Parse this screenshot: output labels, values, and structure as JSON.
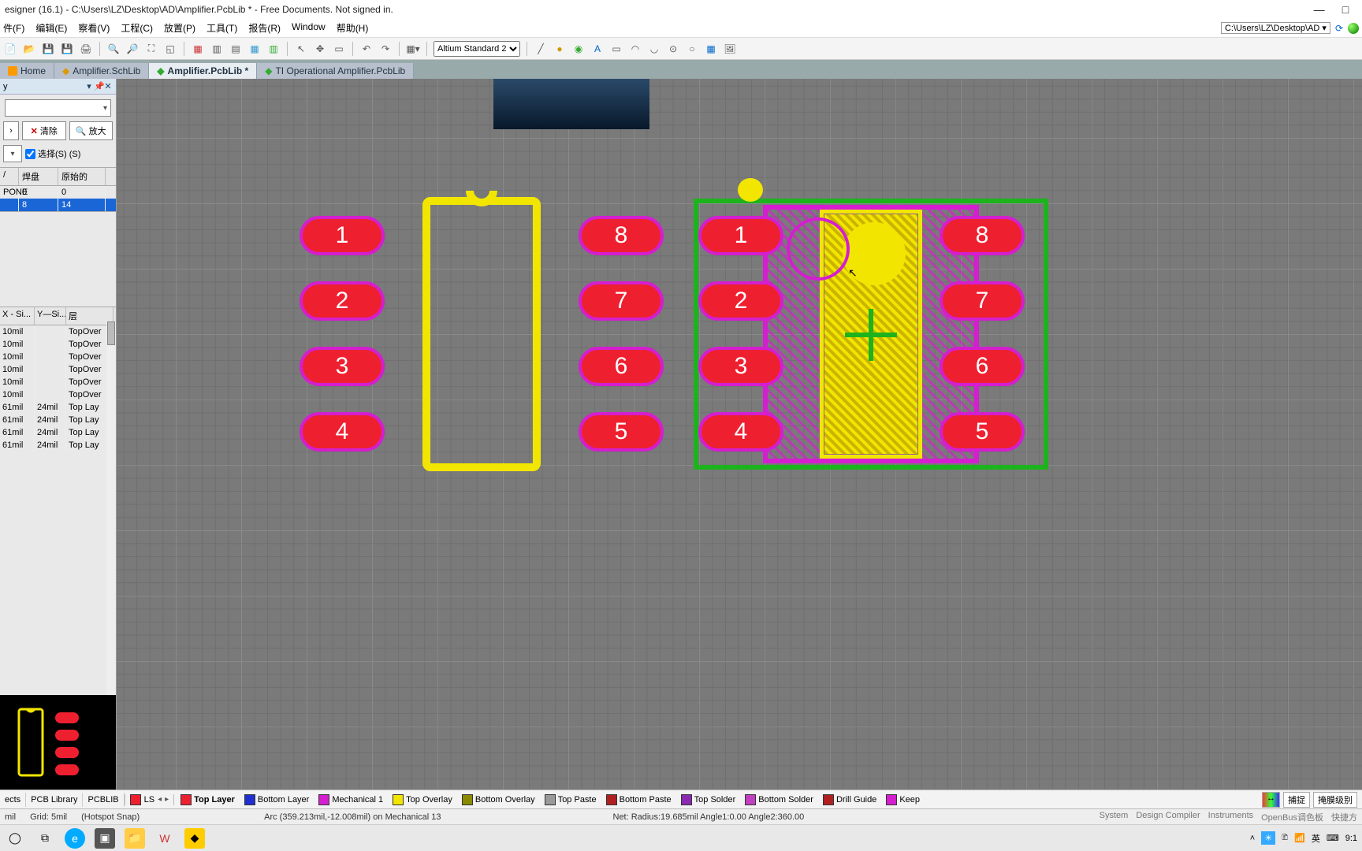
{
  "window": {
    "title": "esigner (16.1) - C:\\Users\\LZ\\Desktop\\AD\\Amplifier.PcbLib * - Free Documents. Not signed in.",
    "path_dd": "C:\\Users\\LZ\\Desktop\\AD"
  },
  "menu": {
    "file": "件(F)",
    "edit": "编辑(E)",
    "view": "察看(V)",
    "project": "工程(C)",
    "place": "放置(P)",
    "tools": "工具(T)",
    "report": "报告(R)",
    "window": "Window",
    "help": "帮助(H)"
  },
  "toolbar": {
    "style_combo": "Altium Standard 2"
  },
  "tabs": {
    "home": "Home",
    "schlib": "Amplifier.SchLib",
    "pcblib": "Amplifier.PcbLib *",
    "ti": "TI Operational Amplifier.PcbLib"
  },
  "panel": {
    "title": "y",
    "clear": "清除",
    "zoom": "放大",
    "select": "选择(S) (S)",
    "grid1": {
      "h1": "/",
      "h2": "焊盘",
      "h3": "原始的",
      "rows": [
        {
          "c1": "PONE",
          "c2": "0",
          "c3": "0"
        },
        {
          "c1": "",
          "c2": "8",
          "c3": "14"
        }
      ],
      "sel": 1
    },
    "grid2": {
      "h1": "X - Si...",
      "h2": "Y—Si...",
      "h3": "层",
      "rows": [
        {
          "c1": "10mil",
          "c2": "",
          "c3": "TopOver"
        },
        {
          "c1": "10mil",
          "c2": "",
          "c3": "TopOver"
        },
        {
          "c1": "10mil",
          "c2": "",
          "c3": "TopOver"
        },
        {
          "c1": "10mil",
          "c2": "",
          "c3": "TopOver"
        },
        {
          "c1": "10mil",
          "c2": "",
          "c3": "TopOver"
        },
        {
          "c1": "10mil",
          "c2": "",
          "c3": "TopOver"
        },
        {
          "c1": "61mil",
          "c2": "24mil",
          "c3": "Top Lay"
        },
        {
          "c1": "61mil",
          "c2": "24mil",
          "c3": "Top Lay"
        },
        {
          "c1": "61mil",
          "c2": "24mil",
          "c3": "Top Lay"
        },
        {
          "c1": "61mil",
          "c2": "24mil",
          "c3": "Top Lay"
        }
      ]
    }
  },
  "layers": {
    "ls": "LS",
    "items": [
      {
        "name": "Top Layer",
        "color": "#ee2030",
        "active": true
      },
      {
        "name": "Bottom Layer",
        "color": "#2030d0"
      },
      {
        "name": "Mechanical 1",
        "color": "#d41ecf"
      },
      {
        "name": "Top Overlay",
        "color": "#f2e600"
      },
      {
        "name": "Bottom Overlay",
        "color": "#8a8a00"
      },
      {
        "name": "Top Paste",
        "color": "#9a9a9a"
      },
      {
        "name": "Bottom Paste",
        "color": "#b02020"
      },
      {
        "name": "Top Solder",
        "color": "#8a2ab0"
      },
      {
        "name": "Bottom Solder",
        "color": "#c040c0"
      },
      {
        "name": "Drill Guide",
        "color": "#b02020"
      },
      {
        "name": "Keep",
        "color": "#d41ecf"
      }
    ],
    "left_tabs": [
      "ects",
      "PCB Library",
      "PCBLIB"
    ],
    "btn_capture": "捕捉",
    "btn_mask": "掩膜级别"
  },
  "status": {
    "seg1": "mil",
    "seg2": "Grid: 5mil",
    "seg3": "(Hotspot Snap)",
    "seg4": "Arc (359.213mil,-12.008mil) on Mechanical 13",
    "seg5": "Net:  Radius:19.685mil Angle1:0.00 Angle2:360.00",
    "links": [
      "System",
      "Design Compiler",
      "Instruments",
      "OpenBus调色板",
      "快捷方"
    ]
  },
  "taskbar": {
    "ime": "英",
    "time": "9:1"
  },
  "canvas": {
    "pads_left": [
      "1",
      "2",
      "3",
      "4"
    ],
    "pads_left2": [
      "8",
      "7",
      "6",
      "5"
    ],
    "pads_r_left": [
      "1",
      "2",
      "3",
      "4"
    ],
    "pads_r_right": [
      "8",
      "7",
      "6",
      "5"
    ]
  }
}
